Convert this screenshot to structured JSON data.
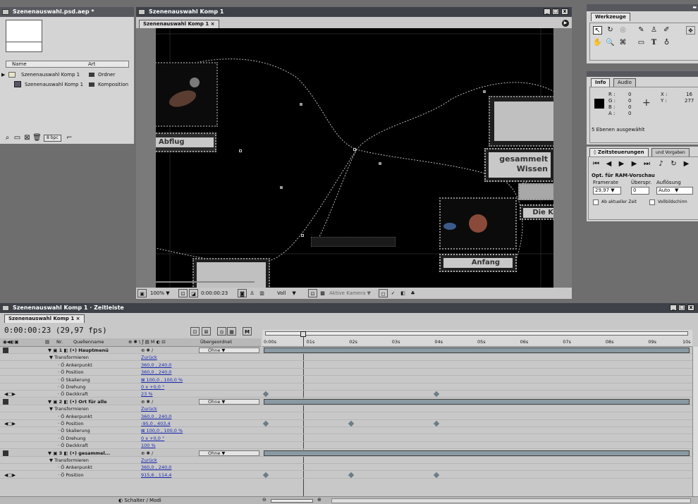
{
  "project_panel": {
    "title": "Szenenauswahl.psd.aep *",
    "columns": {
      "name": "Name",
      "type": "Art"
    },
    "items": [
      {
        "name": "Szenenauswahl Komp 1",
        "type": "Ordner"
      },
      {
        "name": "Szenenauswahl Komp 1",
        "type": "Komposition"
      }
    ],
    "bpc": "8 bpc"
  },
  "comp_window": {
    "title": "Szenenauswahl Komp 1",
    "tab": "Szenenauswahl Komp 1",
    "window_buttons": [
      "_",
      "□",
      "x"
    ],
    "canvas_labels": {
      "abflug": "Abflug",
      "gesammelt_1": "gesammelt",
      "gesammelt_2": "Wissen",
      "die_k": "Die Kr",
      "anfang": "Anfang"
    },
    "bottom_bar": {
      "zoom": "100%",
      "timecode": "0:00:00:23",
      "resolution": "Voll",
      "camera": "Aktive Kamera"
    }
  },
  "tools_panel": {
    "title": "Werkzeuge",
    "row1": [
      "↖",
      "↻",
      "◎",
      "✎",
      "♙",
      "✐"
    ],
    "row2": [
      "✋",
      "🔍",
      "⌘",
      "▭",
      "T",
      "♁"
    ]
  },
  "info_panel": {
    "tabs": [
      "Info",
      "Audio"
    ],
    "r": "R :",
    "r_val": "0",
    "g": "G :",
    "g_val": "0",
    "b": "B :",
    "b_val": "0",
    "a": "A :",
    "a_val": "0",
    "x": "X :",
    "x_val": "16",
    "y": "Y :",
    "y_val": "277",
    "status": "5 Ebenen ausgewählt"
  },
  "time_panel": {
    "tabs": [
      "◊ Zeitsteuerungen",
      "und Vorgaben"
    ],
    "ram_title": "Opt. für RAM-Vorschau",
    "framerate_label": "Framerate",
    "skip_label": "Überspr.",
    "resolution_label": "Auflösung",
    "framerate_value": "29,97",
    "skip_value": "0",
    "resolution_value": "Auto",
    "from_current": "Ab aktueller Zeit",
    "fullscreen": "Vollbildschirm"
  },
  "timeline": {
    "title": "Szenenauswahl Komp 1 · Zeitleiste",
    "tab": "Szenenauswahl Komp 1",
    "timecode": "0:00:00:23 (29,97 fps)",
    "header": {
      "nr": "Nr.",
      "source": "Quellenname",
      "switches": "⊕ ✱ \\ ƒ ▤ M ◐ ⊡",
      "parent": "Übergeordnet"
    },
    "ruler": [
      "0:00s",
      "01s",
      "02s",
      "03s",
      "04s",
      "05s",
      "06s",
      "07s",
      "08s",
      "09s",
      "10s"
    ],
    "rows": [
      {
        "type": "layer",
        "nr": "1",
        "name": "Hauptmenü",
        "val": "⊕ ✱ /",
        "parent": "Ohne"
      },
      {
        "type": "group",
        "name": "Transformieren",
        "val": "Zurück"
      },
      {
        "type": "prop",
        "name": "Ankerpunkt",
        "val": "360,0 , 240,0"
      },
      {
        "type": "prop",
        "name": "Position",
        "val": "360,0 , 240,0"
      },
      {
        "type": "prop",
        "name": "Skalierung",
        "val": "⊠ 100,0 , 100,0 %"
      },
      {
        "type": "prop",
        "name": "Drehung",
        "val": "0 x +0,0 °"
      },
      {
        "type": "prop",
        "name": "Deckkraft",
        "val": "23 %"
      },
      {
        "type": "layer",
        "nr": "2",
        "name": "Ort für alle",
        "val": "⊕ ✱ /",
        "parent": "Ohne"
      },
      {
        "type": "group",
        "name": "Transformieren",
        "val": "Zurück"
      },
      {
        "type": "prop",
        "name": "Ankerpunkt",
        "val": "360,0 , 240,0"
      },
      {
        "type": "prop",
        "name": "Position",
        "val": "-95,0 , 403,4"
      },
      {
        "type": "prop",
        "name": "Skalierung",
        "val": "⊠ 100,0 , 100,0 %"
      },
      {
        "type": "prop",
        "name": "Drehung",
        "val": "0 x +0,0 °"
      },
      {
        "type": "prop",
        "name": "Deckkraft",
        "val": "100 %"
      },
      {
        "type": "layer",
        "nr": "3",
        "name": "gesammel...",
        "val": "⊕ ✱ /",
        "parent": "Ohne"
      },
      {
        "type": "group",
        "name": "Transformieren",
        "val": "Zurück"
      },
      {
        "type": "prop",
        "name": "Ankerpunkt",
        "val": "360,0 , 240,0"
      },
      {
        "type": "prop",
        "name": "Position",
        "val": "915,6 , 114,4"
      }
    ],
    "bottom_toggle": "Schalter / Modi",
    "window_buttons": [
      "_",
      "□",
      "x"
    ]
  },
  "colors": {
    "desktop": "#6e6e6e",
    "panel": "#d4d4d4",
    "title_bar": "#56585e",
    "canvas": "#000000",
    "layer_bar": "#8a9aa3",
    "keyframe": "#6b7d86"
  }
}
